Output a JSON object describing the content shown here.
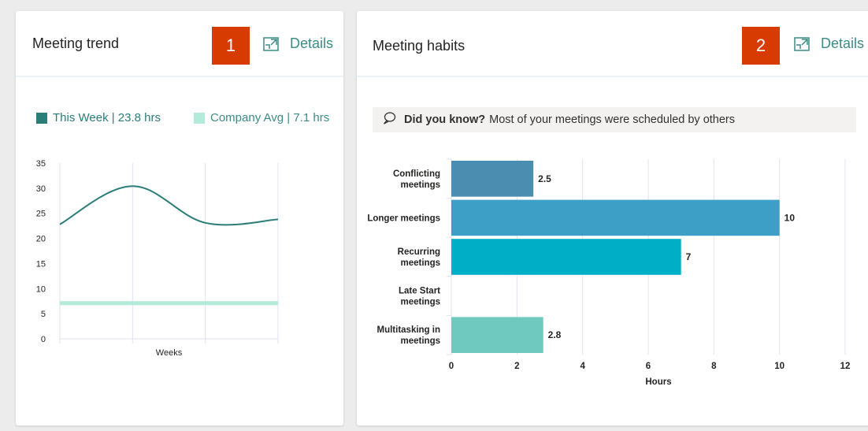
{
  "cards": {
    "meeting_trend": {
      "title": "Meeting trend",
      "badge": "1",
      "details_label": "Details",
      "legend": [
        {
          "label": "This Week | 23.8 hrs",
          "color": "#2b7d78"
        },
        {
          "label": "Company Avg | 7.1 hrs",
          "color": "#b3ead9"
        }
      ]
    },
    "meeting_habits": {
      "title": "Meeting habits",
      "badge": "2",
      "details_label": "Details",
      "tip_bold": "Did you know?",
      "tip_text": "Most of your meetings were scheduled by others"
    }
  },
  "chart_data": [
    {
      "type": "line",
      "xlabel": "Weeks",
      "ylabel": "",
      "ylim": [
        0,
        35
      ],
      "yticks": [
        0,
        5,
        10,
        15,
        20,
        25,
        30,
        35
      ],
      "x": [
        0,
        1,
        2,
        3
      ],
      "grid": true,
      "series": [
        {
          "name": "This Week",
          "color": "#2b7d78",
          "values": [
            22.8,
            30.4,
            23.1,
            23.8
          ]
        },
        {
          "name": "Company Avg",
          "color": "#b3ead9",
          "values": [
            7.1,
            7.1,
            7.1,
            7.1
          ]
        }
      ]
    },
    {
      "type": "bar",
      "orientation": "horizontal",
      "xlabel": "Hours",
      "ylabel": "",
      "xlim": [
        0,
        12
      ],
      "xticks": [
        0,
        2,
        4,
        6,
        8,
        10,
        12
      ],
      "grid": true,
      "categories": [
        "Conflicting meetings",
        "Longer meetings",
        "Recurring meetings",
        "Late Start meetings",
        "Multitasking in meetings"
      ],
      "category_lines": [
        [
          "Conflicting",
          "meetings"
        ],
        [
          "Longer meetings"
        ],
        [
          "Recurring",
          "meetings"
        ],
        [
          "Late Start",
          "meetings"
        ],
        [
          "Multitasking in",
          "meetings"
        ]
      ],
      "values": [
        2.5,
        10,
        7,
        0,
        2.8
      ],
      "value_labels": [
        "2.5",
        "10",
        "7",
        "",
        "2.8"
      ],
      "colors": [
        "#4a8db0",
        "#3d9ec6",
        "#00afc5",
        "#00afc5",
        "#6fc9be"
      ]
    }
  ]
}
